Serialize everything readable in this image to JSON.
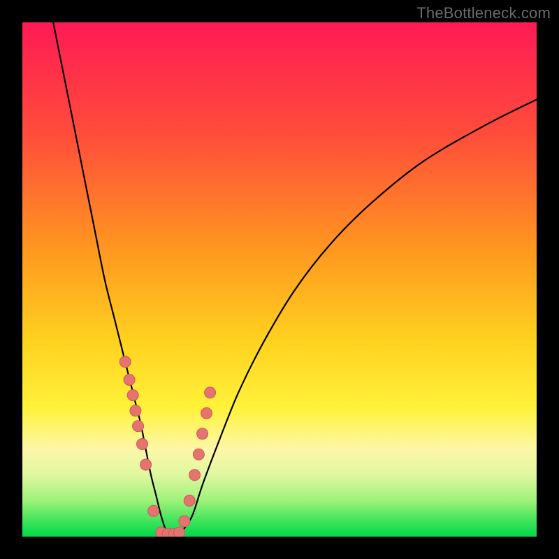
{
  "watermark": "TheBottleneck.com",
  "colors": {
    "bg": "#000000",
    "curve": "#000000",
    "marker_fill": "#e5736f",
    "marker_stroke": "#c95b57"
  },
  "gradient_stops": [
    {
      "pct": 0,
      "color": "#ff1a55"
    },
    {
      "pct": 22,
      "color": "#ff4d3a"
    },
    {
      "pct": 45,
      "color": "#ff9a1f"
    },
    {
      "pct": 62,
      "color": "#ffd21f"
    },
    {
      "pct": 75,
      "color": "#fff23a"
    },
    {
      "pct": 83,
      "color": "#fdf7a8"
    },
    {
      "pct": 88,
      "color": "#dff7a0"
    },
    {
      "pct": 93,
      "color": "#9ef27a"
    },
    {
      "pct": 97,
      "color": "#3ee45a"
    },
    {
      "pct": 100,
      "color": "#00d84a"
    }
  ],
  "chart_data": {
    "type": "line",
    "title": "",
    "xlabel": "",
    "ylabel": "",
    "xlim": [
      0,
      100
    ],
    "ylim": [
      0,
      100
    ],
    "series": [
      {
        "name": "bottleneck-curve",
        "x": [
          6,
          8,
          10,
          12,
          14,
          16,
          18,
          20,
          21,
          22,
          23,
          24,
          25,
          26,
          27,
          28,
          29,
          30,
          31,
          33,
          35,
          38,
          42,
          47,
          53,
          60,
          68,
          78,
          90,
          100
        ],
        "y": [
          100,
          90,
          80,
          70,
          60,
          50,
          42,
          34,
          30,
          26,
          22,
          17,
          12,
          8,
          4,
          1,
          0,
          0,
          1,
          4,
          10,
          18,
          28,
          38,
          48,
          57,
          65,
          73,
          80,
          85
        ]
      }
    ],
    "markers": {
      "name": "highlighted-points",
      "x": [
        20.0,
        20.8,
        21.5,
        22.0,
        22.5,
        23.3,
        24.0,
        25.5,
        27.0,
        28.3,
        29.5,
        30.5,
        31.5,
        32.5,
        33.5,
        34.3,
        35.0,
        35.8,
        36.5
      ],
      "y": [
        34.0,
        30.5,
        27.5,
        24.5,
        21.5,
        18.0,
        14.0,
        5.0,
        0.8,
        0.5,
        0.5,
        0.8,
        3.0,
        7.0,
        12.0,
        16.0,
        20.0,
        24.0,
        28.0
      ]
    }
  }
}
